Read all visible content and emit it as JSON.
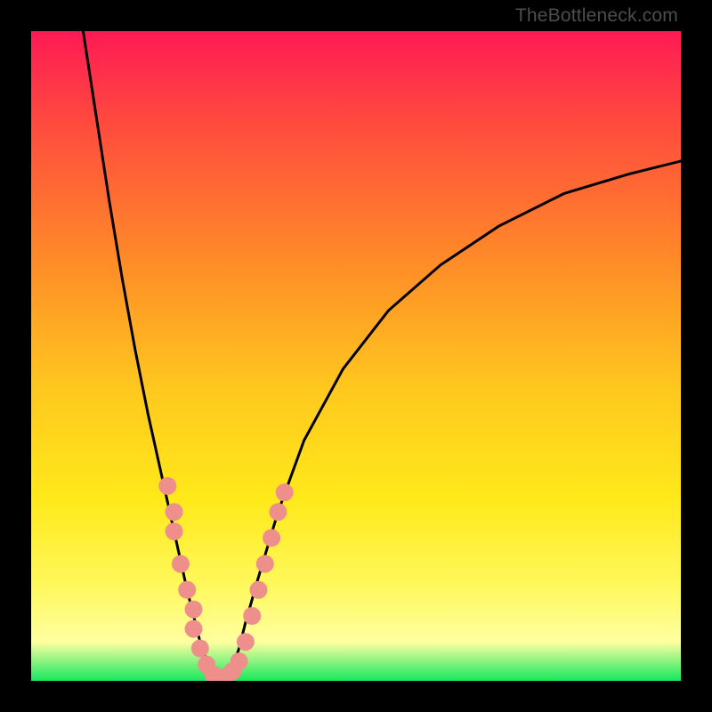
{
  "watermark": "TheBottleneck.com",
  "colors": {
    "frame": "#000000",
    "gradient_top": "#ff1a55",
    "gradient_upper": "#ff4a3e",
    "gradient_mid1": "#ff8a28",
    "gradient_mid2": "#ffc81e",
    "gradient_mid3": "#ffe91a",
    "gradient_lower1": "#fff85a",
    "gradient_lower2": "#ffffa0",
    "gradient_green": "#15e85e",
    "curve": "#000000",
    "marker": "#ef8f8b"
  },
  "chart_data": {
    "type": "line",
    "title": "",
    "xlabel": "",
    "ylabel": "",
    "xlim": [
      0,
      100
    ],
    "ylim": [
      0,
      100
    ],
    "series": [
      {
        "name": "bottleneck-curve",
        "x": [
          8,
          10,
          12,
          14,
          16,
          18,
          20,
          22,
          24,
          25,
          26,
          27,
          28,
          29,
          30,
          31,
          32,
          33,
          35,
          38,
          42,
          48,
          55,
          63,
          72,
          82,
          92,
          100
        ],
        "y": [
          100,
          87,
          74,
          62,
          51,
          41,
          32,
          23,
          14,
          10,
          6,
          3,
          1,
          0.5,
          0.6,
          2,
          5,
          9,
          16,
          26,
          37,
          48,
          57,
          64,
          70,
          75,
          78,
          80
        ]
      }
    ],
    "markers": {
      "name": "highlight-points",
      "x": [
        21,
        22,
        22,
        23,
        24,
        25,
        25,
        26,
        27,
        28,
        29,
        30,
        31,
        32,
        33,
        34,
        35,
        36,
        37,
        38,
        39
      ],
      "y": [
        30,
        26,
        23,
        18,
        14,
        11,
        8,
        5,
        2.5,
        1,
        0.5,
        0.6,
        1.5,
        3,
        6,
        10,
        14,
        18,
        22,
        26,
        29
      ]
    }
  }
}
